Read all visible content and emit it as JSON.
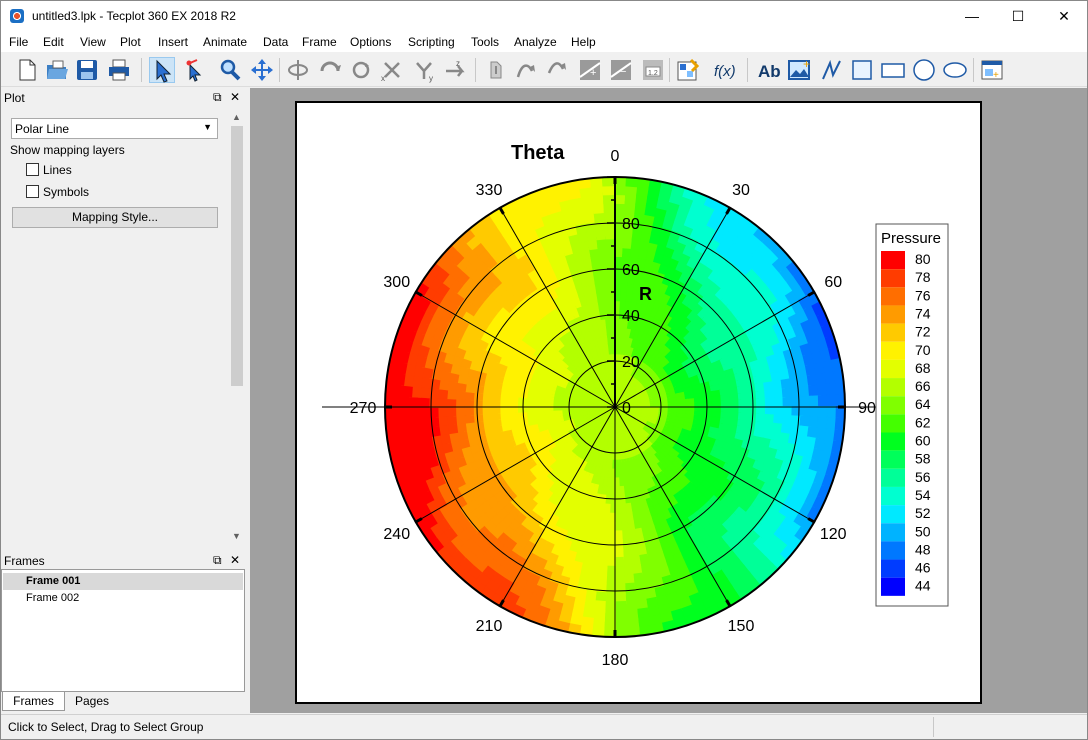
{
  "window": {
    "title": "untitled3.lpk - Tecplot 360 EX 2018 R2",
    "minimize": "—",
    "maximize": "☐",
    "close": "✕"
  },
  "menu": [
    "File",
    "Edit",
    "View",
    "Plot",
    "Insert",
    "Animate",
    "Data",
    "Frame",
    "Options",
    "Scripting",
    "Tools",
    "Analyze",
    "Help"
  ],
  "toolbar": {
    "icons": [
      "new-file",
      "open-file",
      "save",
      "print",
      "select-arrow",
      "adjustor-arrow",
      "zoom",
      "translate",
      "rotate-spherical",
      "rotate-rollerball",
      "twist",
      "rotate-x",
      "rotate-y",
      "rotate-z",
      "probe",
      "streamtrace",
      "extract-slice",
      "contour-add",
      "contour-remove",
      "zone-label",
      "edit-frame",
      "fx-equation",
      "text-tool",
      "insert-image",
      "polyline",
      "square",
      "rectangle",
      "circle",
      "ellipse",
      "frame-new"
    ],
    "fx_label": "f(x)",
    "text_label": "Ab"
  },
  "plot_panel": {
    "header": "Plot",
    "plot_type": "Polar Line",
    "show_mapping_label": "Show mapping layers",
    "layers": [
      {
        "label": "Lines",
        "checked": false
      },
      {
        "label": "Symbols",
        "checked": false
      }
    ],
    "mapping_button": "Mapping Style..."
  },
  "frames_panel": {
    "header": "Frames",
    "items": [
      {
        "label": "Frame 001",
        "active": true
      },
      {
        "label": "Frame 002",
        "active": false
      }
    ],
    "tabs": [
      "Frames",
      "Pages"
    ]
  },
  "status": "Click to Select, Drag to Select Group",
  "plot": {
    "theta_title": "Theta",
    "r_title": "R",
    "theta_ticks": [
      "0",
      "30",
      "60",
      "90",
      "120",
      "150",
      "180",
      "210",
      "240",
      "270",
      "300",
      "330"
    ],
    "r_ticks": [
      "0",
      "20",
      "40",
      "60",
      "80"
    ],
    "legend_title": "Pressure",
    "legend_levels": [
      "80",
      "78",
      "76",
      "74",
      "72",
      "70",
      "68",
      "66",
      "64",
      "62",
      "60",
      "58",
      "56",
      "54",
      "52",
      "50",
      "48",
      "46",
      "44"
    ],
    "legend_colors": [
      "#ff0000",
      "#ff3c00",
      "#ff6e00",
      "#ff9b00",
      "#ffca00",
      "#fff200",
      "#e3ff00",
      "#b3ff00",
      "#80ff00",
      "#44ff00",
      "#00ff1f",
      "#00ff5a",
      "#00ff98",
      "#00ffd0",
      "#00e9ff",
      "#00b3ff",
      "#0078ff",
      "#003cff",
      "#0000ff"
    ]
  }
}
